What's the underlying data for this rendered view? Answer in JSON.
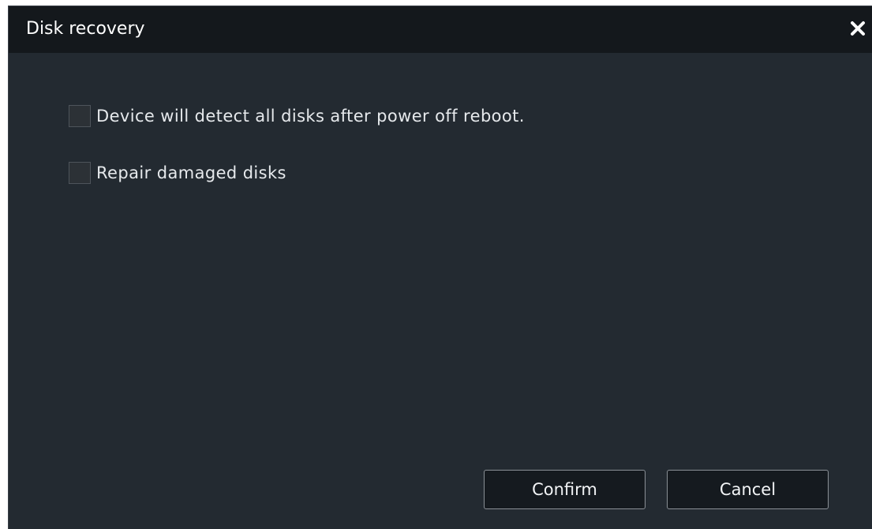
{
  "dialog": {
    "title": "Disk recovery",
    "close_icon": "close-icon"
  },
  "options": [
    {
      "label": "Device will detect all disks after power off reboot.",
      "checked": false
    },
    {
      "label": "Repair damaged disks",
      "checked": false
    }
  ],
  "buttons": {
    "confirm_label": "Confirm",
    "cancel_label": "Cancel"
  },
  "colors": {
    "titlebar_bg": "#14181c",
    "dialog_bg": "#232a31",
    "text": "#e6e9ec"
  }
}
